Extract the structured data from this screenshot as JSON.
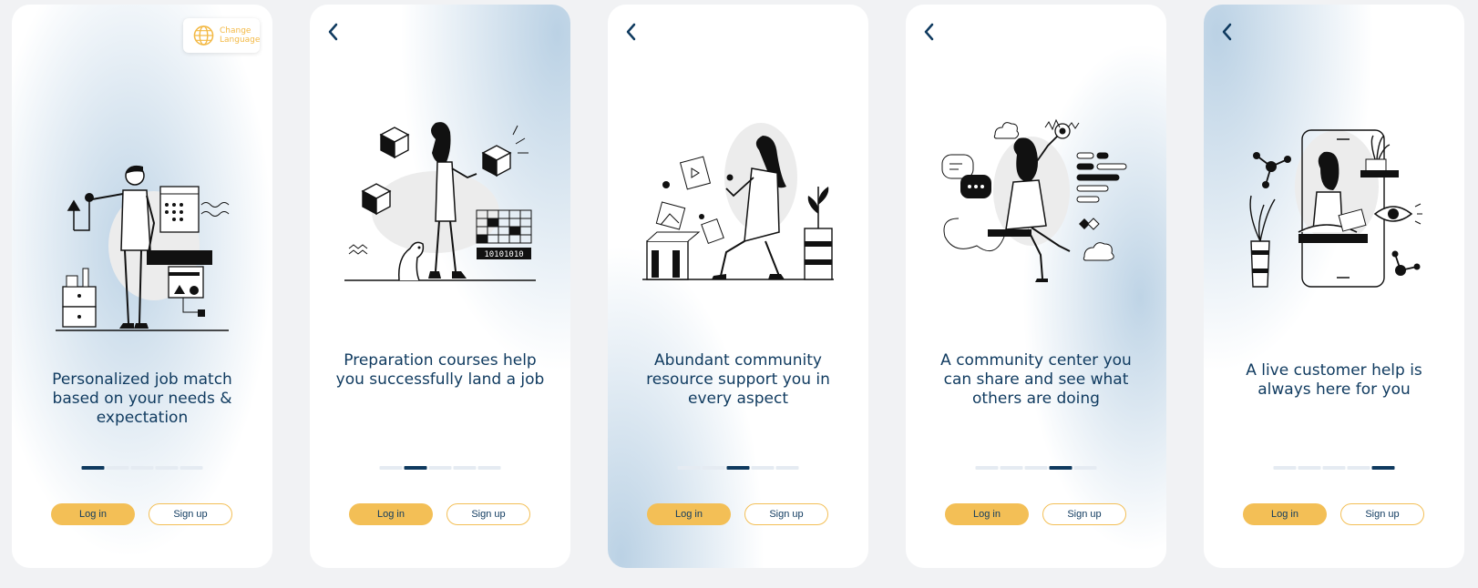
{
  "lang_label": "Change Language",
  "screens": [
    {
      "caption": "Personalized job match based on your needs & expectation",
      "active": 0
    },
    {
      "caption": "Preparation courses help you successfully land a job",
      "active": 1
    },
    {
      "caption": "Abundant community resource support you in every aspect",
      "active": 2
    },
    {
      "caption": "A community center you can share and see what others are doing",
      "active": 3
    },
    {
      "caption": "A live customer help is always here for you",
      "active": 4
    }
  ],
  "login_label": "Log in",
  "signup_label": "Sign up",
  "binary_text": "10101010",
  "colors": {
    "navy": "#0f3a5f",
    "accent": "#f3bf56",
    "glow": "#b7cfe3"
  }
}
